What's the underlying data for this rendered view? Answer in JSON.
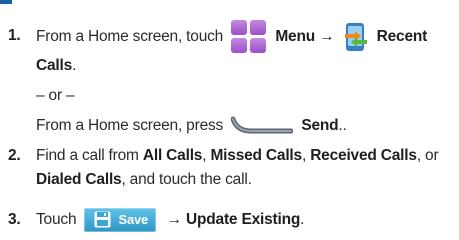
{
  "step1": {
    "number": "1.",
    "text_before_menu": "From a Home screen, touch",
    "menu_label": "Menu",
    "arrow": "→",
    "recent_calls_label_line1": "Recent",
    "recent_calls_label_line2": "Calls",
    "period": ".",
    "or_text": "– or –",
    "alt_text_before_send": "From a Home screen, press",
    "send_label": "Send",
    "alt_period": ".."
  },
  "step2": {
    "number": "2.",
    "text_find": "Find a call from ",
    "all_calls": "All Calls",
    "comma1": ", ",
    "missed_calls": "Missed Calls",
    "comma2": ", ",
    "received_calls": "Received Calls",
    "or_text": ", or",
    "dialed_calls": "Dialed Calls",
    "text_after": ", and touch the call."
  },
  "step3": {
    "number": "3.",
    "touch": "Touch",
    "save_button_label": "Save",
    "arrow": "→",
    "update_existing": "Update Existing",
    "period": "."
  },
  "icons": {
    "menu": "menu-grid-icon",
    "recent_calls": "recent-calls-icon",
    "send_key": "send-key-icon",
    "save_disk": "save-disk-icon"
  },
  "colors": {
    "menu_icon": "#a25fd0",
    "save_button": "#3aa6d6",
    "accent_rule": "#1a5fa8"
  }
}
